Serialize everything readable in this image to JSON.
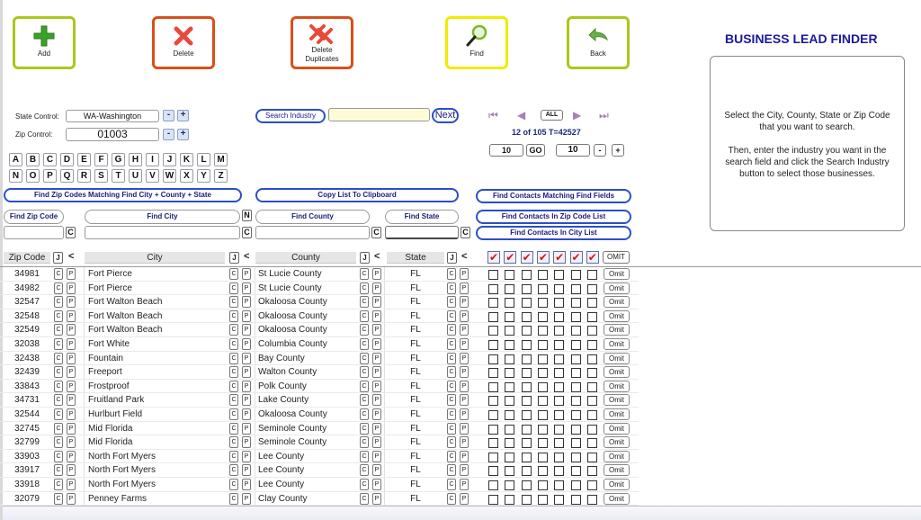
{
  "app": {
    "title": "BUSINESS LEAD FINDER"
  },
  "toolbar": {
    "add_label": "Add",
    "delete_label": "Delete",
    "delete_dup_label_1": "Delete",
    "delete_dup_label_2": "Duplicates",
    "find_label": "Find",
    "back_label": "Back"
  },
  "info": {
    "line1": "Select the City, County, State or Zip Code that you want to search.",
    "line2": "Then, enter the industry you want in the search field  and click the Search Industry button to select those businesses."
  },
  "controls": {
    "state_label": "State Control:",
    "state_value": "WA-Washington",
    "zip_label": "Zip Control:",
    "zip_value": "01003",
    "minus": "-",
    "plus": "+"
  },
  "alphabet": [
    "A",
    "B",
    "C",
    "D",
    "E",
    "F",
    "G",
    "H",
    "I",
    "J",
    "K",
    "L",
    "M",
    "N",
    "O",
    "P",
    "Q",
    "R",
    "S",
    "T",
    "U",
    "V",
    "W",
    "X",
    "Y",
    "Z"
  ],
  "search": {
    "industry_button": "Search Industry",
    "industry_value": "",
    "next_button": "Next"
  },
  "paging": {
    "all_label": "ALL",
    "status": "12 of 105 T=42527",
    "page_size": "10",
    "go_label": "GO",
    "step_value": "10",
    "minus": "-",
    "plus": "+"
  },
  "actions": {
    "find_zip_matching": "Find Zip Codes Matching Find City + County + State",
    "copy_list": "Copy List To Clipboard",
    "find_contacts_fields": "Find Contacts Matching Find Fields",
    "find_contacts_zip": "Find Contacts In Zip Code List",
    "find_contacts_city": "Find Contacts In City List"
  },
  "filters": {
    "find_zip": "Find Zip Code",
    "find_city": "Find City",
    "find_county": "Find County",
    "find_state": "Find State",
    "n_label": "N",
    "c_label": "C",
    "zip_value": "",
    "city_value": "",
    "county_value": "",
    "state_value": ""
  },
  "table": {
    "headers": {
      "zip": "Zip Code",
      "city": "City",
      "county": "County",
      "state": "State",
      "j": "J",
      "back": "<",
      "omit": "OMIT",
      "check": "✔"
    },
    "c_label": "C",
    "p_label": "P",
    "omit_label": "Omit",
    "rows": [
      {
        "zip": "34981",
        "city": "Fort Pierce",
        "county": "St Lucie County",
        "state": "FL"
      },
      {
        "zip": "34982",
        "city": "Fort Pierce",
        "county": "St Lucie County",
        "state": "FL"
      },
      {
        "zip": "32547",
        "city": "Fort Walton Beach",
        "county": "Okaloosa County",
        "state": "FL"
      },
      {
        "zip": "32548",
        "city": "Fort Walton Beach",
        "county": "Okaloosa County",
        "state": "FL"
      },
      {
        "zip": "32549",
        "city": "Fort Walton Beach",
        "county": "Okaloosa County",
        "state": "FL"
      },
      {
        "zip": "32038",
        "city": "Fort White",
        "county": "Columbia County",
        "state": "FL"
      },
      {
        "zip": "32438",
        "city": "Fountain",
        "county": "Bay County",
        "state": "FL"
      },
      {
        "zip": "32439",
        "city": "Freeport",
        "county": "Walton County",
        "state": "FL"
      },
      {
        "zip": "33843",
        "city": "Frostproof",
        "county": "Polk County",
        "state": "FL"
      },
      {
        "zip": "34731",
        "city": "Fruitland Park",
        "county": "Lake County",
        "state": "FL"
      },
      {
        "zip": "32544",
        "city": "Hurlburt Field",
        "county": "Okaloosa County",
        "state": "FL"
      },
      {
        "zip": "32745",
        "city": "Mid Florida",
        "county": "Seminole County",
        "state": "FL"
      },
      {
        "zip": "32799",
        "city": "Mid Florida",
        "county": "Seminole County",
        "state": "FL"
      },
      {
        "zip": "33903",
        "city": "North Fort Myers",
        "county": "Lee County",
        "state": "FL"
      },
      {
        "zip": "33917",
        "city": "North Fort Myers",
        "county": "Lee County",
        "state": "FL"
      },
      {
        "zip": "33918",
        "city": "North Fort Myers",
        "county": "Lee County",
        "state": "FL"
      },
      {
        "zip": "32079",
        "city": "Penney Farms",
        "county": "Clay County",
        "state": "FL"
      }
    ]
  },
  "colors": {
    "brand": "#1a1a9a",
    "accent_blue": "#2a4fc8",
    "green_border": "#a8c81a",
    "red_border": "#d94f1a",
    "yellow_border": "#f0ec00",
    "nav_purple": "#a880b8"
  }
}
